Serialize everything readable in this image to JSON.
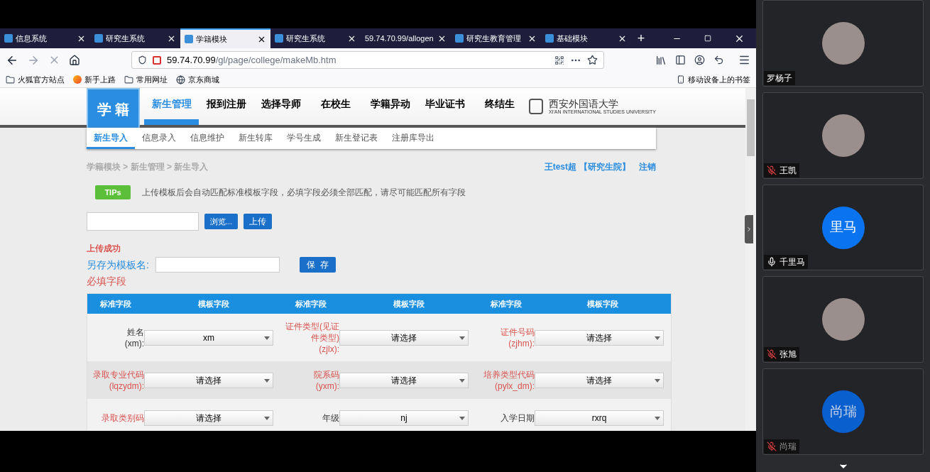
{
  "browser": {
    "tabs": [
      {
        "label": "信息系统",
        "selected": false,
        "icon": true
      },
      {
        "label": "研究生系统",
        "selected": false,
        "icon": true
      },
      {
        "label": "学籍模块",
        "selected": true,
        "icon": true
      },
      {
        "label": "研究生系统",
        "selected": false,
        "icon": true
      },
      {
        "label": "59.74.70.99/allogen",
        "selected": false,
        "icon": false
      },
      {
        "label": "研究生教育管理",
        "selected": false,
        "icon": true
      },
      {
        "label": "基础模块",
        "selected": false,
        "icon": true
      }
    ],
    "new_tab": "+",
    "url_host": "59.74.70.99",
    "url_path": "/gl/page/college/makeMb.htm",
    "bookmarks": [
      {
        "label": "火狐官方站点",
        "kind": "folder"
      },
      {
        "label": "新手上路",
        "kind": "browser"
      },
      {
        "label": "常用网址",
        "kind": "folder"
      },
      {
        "label": "京东商城",
        "kind": "globe"
      }
    ],
    "mobile_bookmarks": "移动设备上的书签"
  },
  "page": {
    "logo": "学 籍",
    "nav": [
      {
        "label": "新生管理",
        "selected": true
      },
      {
        "label": "报到注册",
        "selected": false
      },
      {
        "label": "选择导师",
        "selected": false
      },
      {
        "label": "在校生",
        "selected": false
      },
      {
        "label": "学籍异动",
        "selected": false
      },
      {
        "label": "毕业证书",
        "selected": false
      },
      {
        "label": "终结生",
        "selected": false
      }
    ],
    "university": "西安外国语大学",
    "university_en": "XI'AN INTERNATIONAL STUDIES UNIVERSITY",
    "subnav": [
      {
        "label": "新生导入",
        "selected": true
      },
      {
        "label": "信息录入",
        "selected": false
      },
      {
        "label": "信息维护",
        "selected": false
      },
      {
        "label": "新生转库",
        "selected": false
      },
      {
        "label": "学号生成",
        "selected": false
      },
      {
        "label": "新生登记表",
        "selected": false
      },
      {
        "label": "注册库导出",
        "selected": false
      }
    ],
    "breadcrumb": "学籍模块 > 新生管理 > 新生导入",
    "user": "王test超",
    "role": "【研究生院】",
    "logout": "注销",
    "tips_badge": "TIPs",
    "tips": "上传模板后会自动匹配标准模板字段，必填字段必须全部匹配，请尽可能匹配所有字段",
    "browse_button": "浏览...",
    "upload_button": "上传",
    "status": "上传成功",
    "save_as_label": "另存为模板名:",
    "save_button": "保  存",
    "required_title": "必填字段",
    "columns": [
      "标准字段",
      "模板字段",
      "标准字段",
      "模板字段",
      "标准字段",
      "模板字段"
    ],
    "rows": [
      [
        {
          "kind": "label",
          "label": "姓名",
          "code": "(xm):",
          "required": false
        },
        {
          "kind": "select",
          "value": "xm"
        },
        {
          "kind": "label",
          "label": "证件类型(见证件类型)",
          "code": "(zjlx):",
          "required": true
        },
        {
          "kind": "select",
          "value": "请选择"
        },
        {
          "kind": "label",
          "label": "证件号码",
          "code": "(zjhm):",
          "required": true
        },
        {
          "kind": "select",
          "value": "请选择"
        }
      ],
      [
        {
          "kind": "label",
          "label": "录取专业代码",
          "code": "(lqzydm):",
          "required": true
        },
        {
          "kind": "select",
          "value": "请选择"
        },
        {
          "kind": "label",
          "label": "院系码",
          "code": "(yxm):",
          "required": true
        },
        {
          "kind": "select",
          "value": "请选择"
        },
        {
          "kind": "label",
          "label": "培养类型代码",
          "code": "(pylx_dm):",
          "required": true
        },
        {
          "kind": "select",
          "value": "请选择"
        }
      ],
      [
        {
          "kind": "label",
          "label": "录取类别码",
          "required": true
        },
        {
          "kind": "select",
          "value": "请选择"
        },
        {
          "kind": "label",
          "label": "年级",
          "required": false
        },
        {
          "kind": "select",
          "value": "nj"
        },
        {
          "kind": "label",
          "label": "入学日期",
          "required": false
        },
        {
          "kind": "select",
          "value": "rxrq"
        }
      ]
    ]
  },
  "participants": [
    {
      "name": "罗杨子",
      "kind": "photo",
      "dimmed": false
    },
    {
      "name": "王凯",
      "muted": true,
      "kind": "photo",
      "dimmed": false
    },
    {
      "name": "千里马",
      "muted": false,
      "kind": "initials",
      "initials": "里马",
      "dimmed": false
    },
    {
      "name": "张旭",
      "muted": true,
      "kind": "photo",
      "dimmed": false
    },
    {
      "name": "尚瑞",
      "muted": true,
      "kind": "initials",
      "initials": "尚瑞",
      "dimmed": true
    }
  ]
}
